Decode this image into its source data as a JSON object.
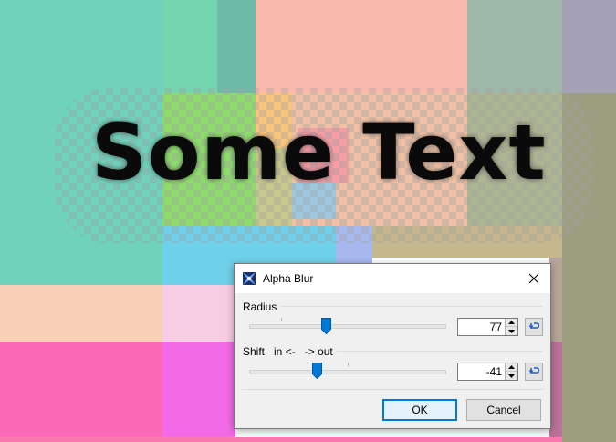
{
  "canvas": {
    "text": "Some Text",
    "colors": {
      "teal": "#6fd2bc",
      "peach": "#fab8ab",
      "grey_green": "#9fb9a8",
      "lavender": "#a4a0b6",
      "green": "#8fdc6e",
      "orange": "#fac57f",
      "olive": "#aeb592",
      "light_peach": "#f8d0b6",
      "sky": "#6fd0ea",
      "pink_light": "#f6cde2",
      "pink_hot": "#fa6ab6",
      "magenta": "#f36ae6",
      "mauve": "#d76ea5",
      "rose": "#ba739a",
      "khaki": "#9d9e80"
    }
  },
  "dialog": {
    "title": "Alpha Blur",
    "app_icon": "blur-icon",
    "close_icon": "close-icon",
    "radius": {
      "label": "Radius",
      "value": "77",
      "min": 0,
      "max": 200,
      "level": 0.385
    },
    "shift": {
      "label": "Shift   in <-   -> out",
      "value": "-41",
      "min": -100,
      "max": 100,
      "level": 0.3
    },
    "reset_icon": "reset-arrow-icon",
    "ok_label": "OK",
    "cancel_label": "Cancel",
    "accent": "#0078d7"
  }
}
